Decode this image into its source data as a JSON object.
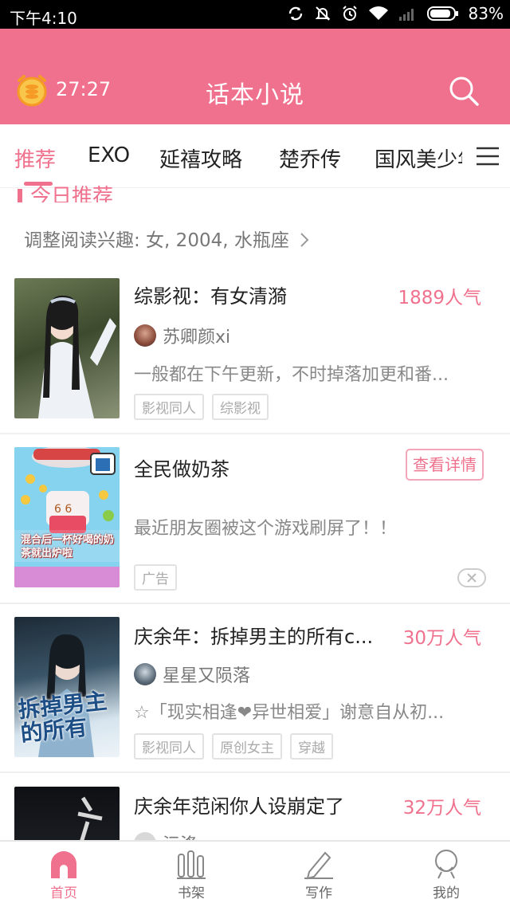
{
  "status_bar": {
    "time": "下午4:10",
    "battery": "83%"
  },
  "header": {
    "timer": "27:27",
    "title": "话本小说"
  },
  "tabs": [
    {
      "label": "推荐"
    },
    {
      "label": "EXO"
    },
    {
      "label": "延禧攻略"
    },
    {
      "label": "楚乔传"
    },
    {
      "label": "国风美少年"
    }
  ],
  "section": {
    "heading": "今日推荐",
    "interest": "调整阅读兴趣: 女, 2004, 水瓶座"
  },
  "books": [
    {
      "title": "综影视：有女清漪",
      "popularity": "1889人气",
      "author": "苏卿颜xi",
      "description": "一般都在下午更新，不时掉落加更和番...",
      "tags": [
        "影视同人",
        "综影视"
      ]
    },
    {
      "title": "庆余年：拆掉男主的所有c...",
      "popularity": "30万人气",
      "author": "星星又陨落",
      "description": "☆「现实相逢❤异世相爱」谢意自从初...",
      "tags": [
        "影视同人",
        "原创女主",
        "穿越"
      ],
      "cover_text": "拆掉男主的所有"
    },
    {
      "title": "庆余年范闲你人设崩定了",
      "popularity": "32万人气",
      "author": "沄涤"
    }
  ],
  "ad": {
    "title": "全民做奶茶",
    "button": "查看详情",
    "description": "最近朋友圈被这个游戏刷屏了！！",
    "tag": "广告",
    "cover_text": "混合后一杯好喝的奶茶就出炉啦"
  },
  "bottom_nav": [
    {
      "label": "首页"
    },
    {
      "label": "书架"
    },
    {
      "label": "写作"
    },
    {
      "label": "我的"
    }
  ],
  "colors": {
    "brand": "#f0718d",
    "status_bar": "#000000"
  }
}
